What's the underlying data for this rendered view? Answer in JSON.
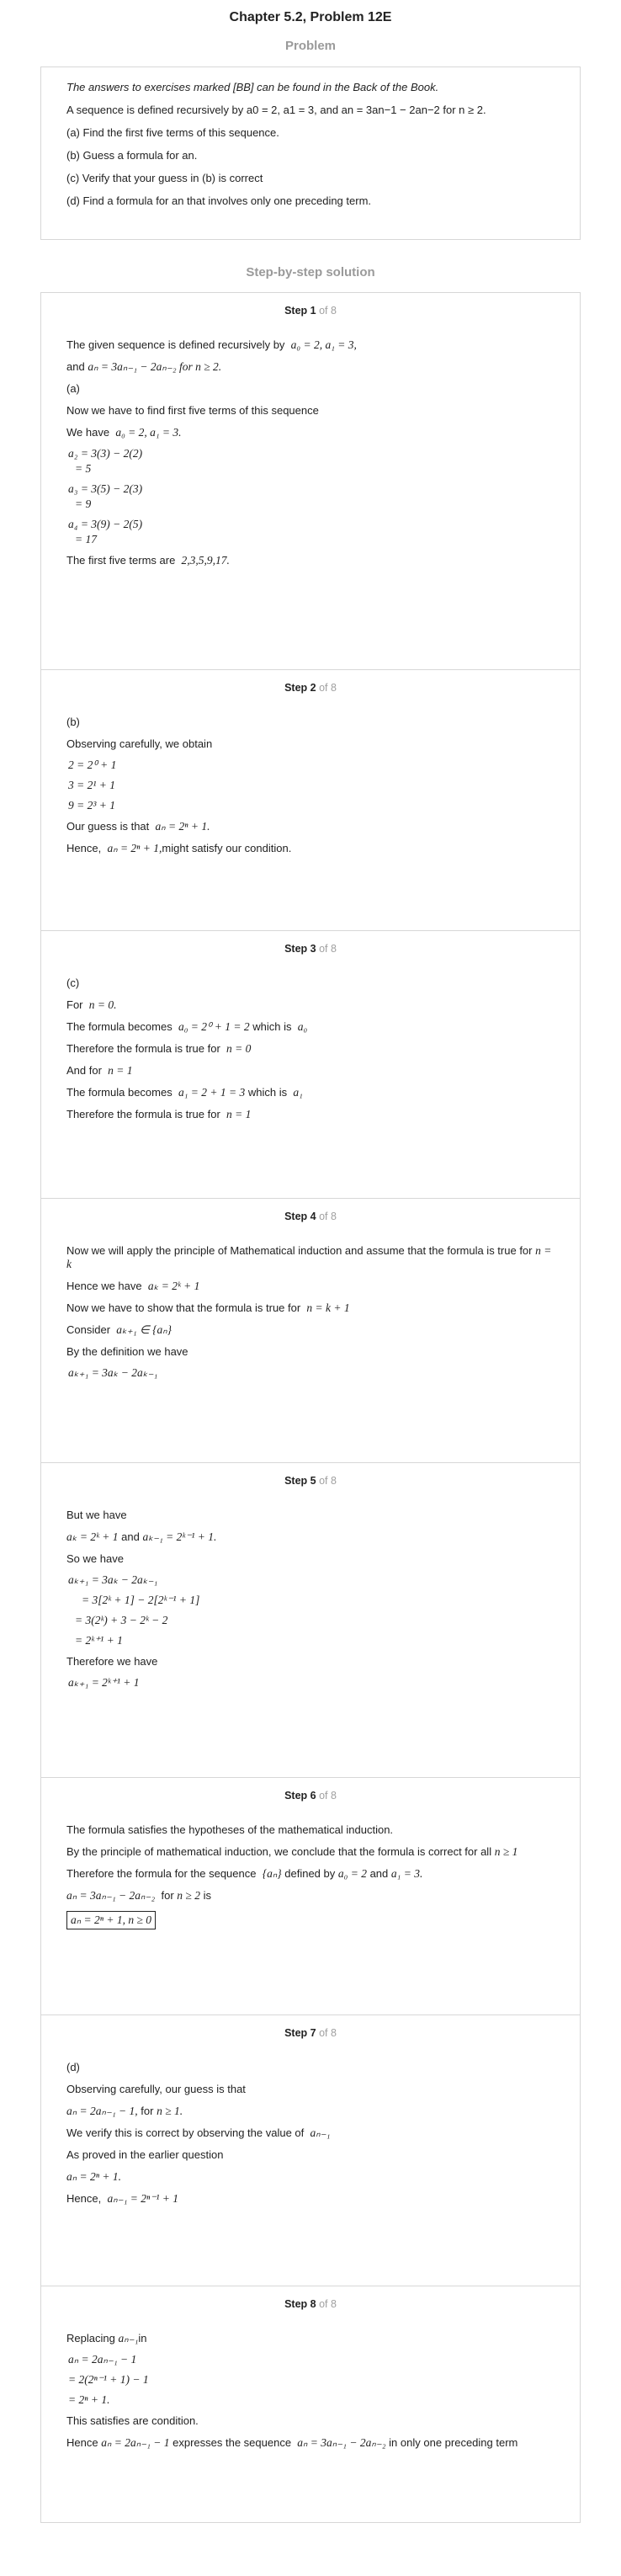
{
  "header": {
    "title": "Chapter 5.2, Problem 12E",
    "subtitle": "Problem"
  },
  "problem": {
    "note": "The answers to exercises marked [BB] can be found in the Back of the Book.",
    "statement": "A sequence is defined recursively by a0 = 2, a1 = 3, and an = 3an−1 − 2an−2 for n ≥ 2.",
    "a": "(a) Find the first five terms of this sequence.",
    "b": "(b) Guess a formula for an.",
    "c": "(c) Verify that your guess in (b) is correct",
    "d": "(d) Find a formula for an that involves only one preceding term."
  },
  "solution_title": "Step-by-step solution",
  "total": "of 8",
  "steps": [
    {
      "label": "Step 1",
      "lines": {
        "l1": "The given sequence is defined recursively by",
        "m1": "a₀ = 2, a₁ = 3,",
        "l2a": "and",
        "m2": "aₙ = 3aₙ₋₁ − 2aₙ₋₂ for n ≥ 2.",
        "l3": "(a)",
        "l4": "Now we have to find first five terms of this sequence",
        "l5": "We have",
        "m5": "a₀ = 2, a₁ = 3.",
        "e1": "a₂ = 3(3) − 2(2)",
        "e2": "= 5",
        "e3": "a₃ = 3(5) − 2(3)",
        "e4": "= 9",
        "e5": "a₄ = 3(9) − 2(5)",
        "e6": "= 17",
        "l6": "The first five terms are",
        "m6": "2,3,5,9,17."
      }
    },
    {
      "label": "Step 2",
      "lines": {
        "l1": "(b)",
        "l2": "Observing carefully, we obtain",
        "e1": "2 = 2⁰ + 1",
        "e2": "3 = 2¹ + 1",
        "e3": "9 = 2³ + 1",
        "l3": "Our guess is that",
        "m3": "aₙ = 2ⁿ + 1.",
        "l4a": "Hence,",
        "m4": "aₙ = 2ⁿ + 1,",
        "l4b": "might satisfy our condition."
      }
    },
    {
      "label": "Step 3",
      "lines": {
        "l1": "(c)",
        "l2": "For",
        "m2": "n = 0.",
        "l3": "The formula becomes",
        "m3": "a₀ = 2⁰ + 1 = 2",
        "l3b": "which is",
        "m3b": "a₀",
        "l4": "Therefore the formula is true for",
        "m4": "n = 0",
        "l5": "And for",
        "m5": "n = 1",
        "l6": "The formula becomes",
        "m6": "a₁ = 2 + 1 = 3",
        "l6b": "which is",
        "m6b": "a₁",
        "l7": "Therefore the formula is true for",
        "m7": "n = 1"
      }
    },
    {
      "label": "Step 4",
      "lines": {
        "l1": "Now we will apply the principle of Mathematical induction and assume that the formula is true for",
        "m1": "n = k",
        "l2": "Hence we have",
        "m2": "aₖ = 2ᵏ + 1",
        "l3": "Now we have to show that the formula is true for",
        "m3": "n = k + 1",
        "l4": "Consider",
        "m4": "aₖ₊₁ ∈ {aₙ}",
        "l5": "By the definition we have",
        "e1": "aₖ₊₁ = 3aₖ − 2aₖ₋₁"
      }
    },
    {
      "label": "Step 5",
      "lines": {
        "l1": "But we have",
        "m2": "aₖ = 2ᵏ + 1",
        "l2b": "and",
        "m2b": "aₖ₋₁ = 2ᵏ⁻¹ + 1.",
        "l3": "So we have",
        "e1": "aₖ₊₁ = 3aₖ − 2aₖ₋₁",
        "e2": "= 3[2ᵏ + 1] − 2[2ᵏ⁻¹ + 1]",
        "e3": "= 3(2ᵏ) + 3 − 2ᵏ − 2",
        "e4": "= 2ᵏ⁺¹ + 1",
        "l4": "Therefore we have",
        "e5": "aₖ₊₁ = 2ᵏ⁺¹ + 1"
      }
    },
    {
      "label": "Step 6",
      "lines": {
        "l1": "The formula satisfies the hypotheses of the mathematical induction.",
        "l2": "By the principle of mathematical induction, we conclude that the formula is correct for all",
        "m2": "n ≥ 1",
        "l3": "Therefore the formula for the sequence",
        "m3": "{aₙ}",
        "l3b": "defined by",
        "m3b": "a₀ = 2",
        "l3c": "and",
        "m3c": "a₁ = 3.",
        "m4": "aₙ = 3aₙ₋₁ − 2aₙ₋₂",
        "l4b": "for",
        "m4b": "n ≥ 2",
        "l4c": "is",
        "m5": "aₙ = 2ⁿ + 1, n ≥ 0"
      }
    },
    {
      "label": "Step 7",
      "lines": {
        "l1": "(d)",
        "l2": "Observing carefully, our guess is that",
        "m3": "aₙ = 2aₙ₋₁ − 1,",
        "l3b": "for",
        "m3b": "n ≥ 1.",
        "l4": "We verify this is correct by observing the value of",
        "m4": "aₙ₋₁",
        "l5": "As proved in the earlier question",
        "m6": "aₙ = 2ⁿ + 1.",
        "l7": "Hence,",
        "m7": "aₙ₋₁ = 2ⁿ⁻¹ + 1"
      }
    },
    {
      "label": "Step 8",
      "lines": {
        "l1": "Replacing",
        "m1": "aₙ₋₁",
        "l1b": "in",
        "e1": "aₙ = 2aₙ₋₁ − 1",
        "e2": "= 2(2ⁿ⁻¹ + 1) − 1",
        "e3": "= 2ⁿ + 1.",
        "l2": "This satisfies are condition.",
        "l3": "Hence",
        "m3": "aₙ = 2aₙ₋₁ − 1",
        "l3b": "expresses the sequence",
        "m3b": "aₙ = 3aₙ₋₁ − 2aₙ₋₂",
        "l3c": "in only one preceding term"
      }
    }
  ]
}
